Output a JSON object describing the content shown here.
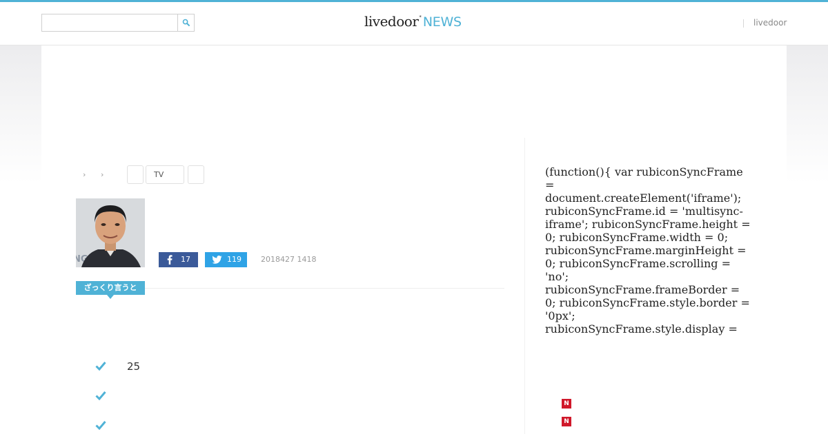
{
  "header": {
    "search": {
      "placeholder": "",
      "value": ""
    },
    "logo": {
      "main": "livedoor",
      "star": "*",
      "news": "NEWS"
    },
    "link": "livedoor"
  },
  "breadcrumb": {
    "arrows": [
      "›",
      "›"
    ],
    "tags": [
      "",
      "TV",
      ""
    ]
  },
  "article": {
    "share": {
      "facebook_count": "17",
      "twitter_count": "119"
    },
    "date": "2018427 1418",
    "summary_label": "ざっくり言うと",
    "points": [
      "25",
      "",
      ""
    ]
  },
  "sidebar": {
    "code_text": "(function(){ var rubiconSyncFrame = document.createElement('iframe'); rubiconSyncFrame.id = 'multisync-iframe'; rubiconSyncFrame.height = 0; rubiconSyncFrame.width = 0; rubiconSyncFrame.marginHeight = 0; rubiconSyncFrame.scrolling = 'no'; rubiconSyncFrame.frameBorder = 0; rubiconSyncFrame.style.border = '0px'; rubiconSyncFrame.style.display = 'none';",
    "badges": [
      "N",
      "N"
    ]
  },
  "colors": {
    "accent": "#4fb2d6",
    "facebook": "#3b5a99",
    "twitter": "#2fa3e6",
    "badge": "#d0192b"
  },
  "icons": [
    "search-icon",
    "facebook-icon",
    "twitter-icon",
    "check-icon"
  ]
}
